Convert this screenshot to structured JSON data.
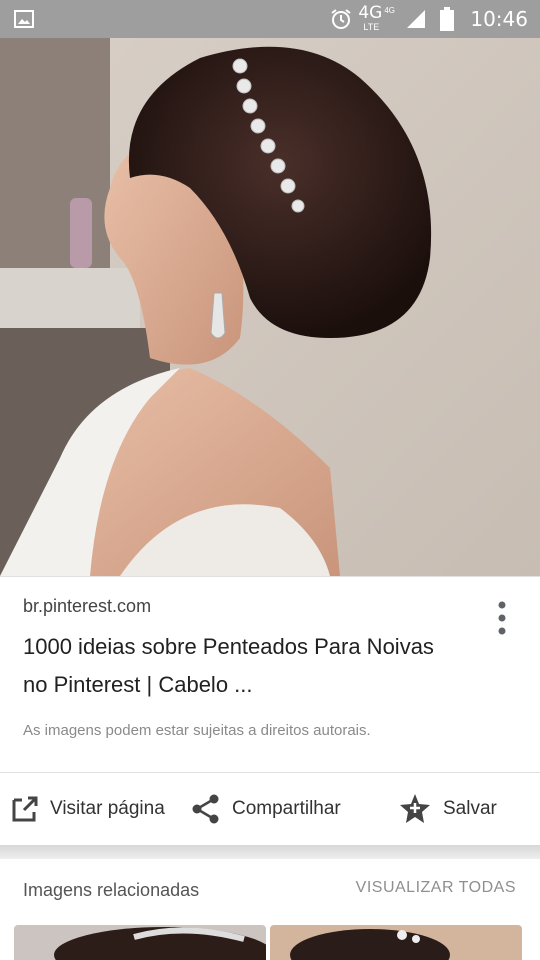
{
  "status_bar": {
    "network": "4G",
    "network_sub": "4G",
    "network_tech": "LTE",
    "time": "10:46"
  },
  "result": {
    "domain": "br.pinterest.com",
    "title": "1000 ideias sobre Penteados Para Noivas no Pinterest | Cabelo ...",
    "notice": "As imagens podem estar sujeitas a direitos autorais."
  },
  "actions": {
    "visit": "Visitar página",
    "share": "Compartilhar",
    "save": "Salvar"
  },
  "related": {
    "title": "Imagens relacionadas",
    "view_all": "VISUALIZAR TODAS"
  },
  "icons": [
    "image-icon",
    "alarm-icon",
    "signal-icon",
    "battery-icon",
    "more-vert-icon",
    "open-in-new-icon",
    "share-icon",
    "star-add-icon"
  ]
}
